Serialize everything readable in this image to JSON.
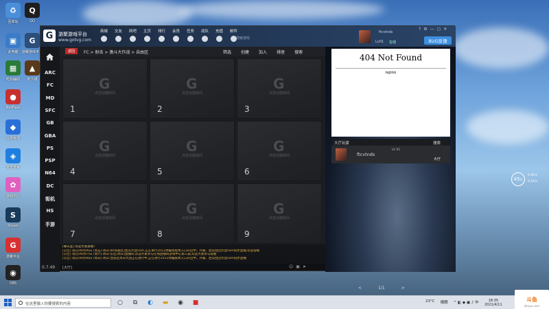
{
  "desktop": {
    "icons": [
      {
        "label": "回收站",
        "color": "#4a8fd8",
        "glyph": "♻"
      },
      {
        "label": "QQ",
        "color": "#1e1e1e",
        "glyph": "Q"
      },
      {
        "label": "此电脑",
        "color": "#3a7cc8",
        "glyph": "▣"
      },
      {
        "label": "游聚游戏平台",
        "color": "#2b4e7a",
        "glyph": "G"
      },
      {
        "label": "吃鸡辅助",
        "color": "#2a7a3a",
        "glyph": "▦"
      },
      {
        "label": "地下城",
        "color": "#5a3a1a",
        "glyph": "▲"
      },
      {
        "label": "NetEase",
        "color": "#c83030",
        "glyph": "●"
      },
      {
        "label": "任务管理",
        "color": "#2a6fd8",
        "glyph": "◆"
      },
      {
        "label": "安全管家",
        "color": "#1e7fe0",
        "glyph": "◈"
      },
      {
        "label": "游戏中心",
        "color": "#e060c0",
        "glyph": "✿"
      },
      {
        "label": "Steam",
        "color": "#1a3a5a",
        "glyph": "S"
      },
      {
        "label": "游聚平台",
        "color": "#d83030",
        "glyph": "G"
      },
      {
        "label": "OBS",
        "color": "#222",
        "glyph": "◉"
      }
    ]
  },
  "app": {
    "name": "游聚游戏平台",
    "url": "www.gotvg.com",
    "nav": [
      "商城",
      "交友",
      "网吧",
      "主页",
      "排行",
      "会员",
      "任务",
      "战队",
      "充值",
      "邮件"
    ],
    "search_hint": "搜索游戏",
    "user": {
      "name": "ftcvtnds",
      "level": "Lv01",
      "status": "在线"
    },
    "bug_button": "BUG反馈",
    "window_controls": [
      "?",
      "⚙",
      "—",
      "▢",
      "✕"
    ],
    "version": "0.7.49",
    "platforms": [
      "ARC",
      "FC",
      "MD",
      "SFC",
      "GB",
      "GBA",
      "PS",
      "PSP",
      "N64",
      "DC",
      "街机",
      "HS",
      "手游"
    ]
  },
  "crumbbar": {
    "back": "返回",
    "path": "FC > 射击 > 激斗大作战 > 自由区",
    "actions": [
      "筛选",
      "创建",
      "加入",
      "排座",
      "搜索"
    ]
  },
  "rooms": {
    "hint": "点击创建房间",
    "items": [
      "1",
      "2",
      "3",
      "4",
      "5",
      "6",
      "7",
      "8",
      "9"
    ]
  },
  "chat": {
    "lines": [
      "[聊天室] 欢迎大家观看!",
      "[公告] 现在04月06日 (周五)-周日:新(私服区)西瓜大战5am.正在进行2012改编到版本入口开启中。外服、西瓜拉回大战5am同步直播,欢迎观看",
      "[公告] 现在04月07日 (周六)-周日:东区[周日]直播间,欢迎大家参与在线直播间游戏中心第三届,欢迎大家参与观看",
      "[公告] 现在04月08日 (周日)-周日:西游区周日大战正在进行中,正在进行2012改编版本入口开启中。外服、西瓜拉回大战5am同步直播"
    ],
    "tag": "[大厅]"
  },
  "right_panel": {
    "error_title": "404 Not Found",
    "server": "nginx",
    "lobby_title": "大厅玩家",
    "lobby_search": "搜索",
    "player": {
      "name": "ftcvtnds",
      "level": "LV 01",
      "badge": "大厅"
    },
    "pager": {
      "prev": "<",
      "page": "1/1",
      "next": ">"
    }
  },
  "weather": {
    "value": "45",
    "unit": "%",
    "up": "0.2K/s",
    "down": "0.1K/s"
  },
  "taskbar": {
    "search_placeholder": "在这里输入你要搜索的内容",
    "tray_temp": "23°C",
    "tray_weather": "晴朗",
    "time": "18:35",
    "date": "2021/4/11"
  },
  "watermark": {
    "brand": "斗鱼",
    "url": "douyu.com"
  }
}
